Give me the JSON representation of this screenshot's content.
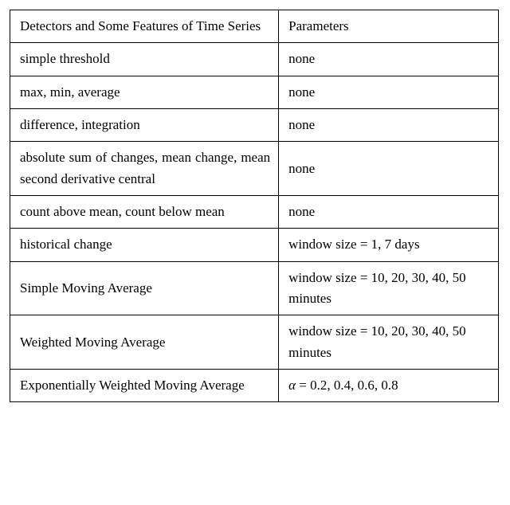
{
  "chart_data": {
    "type": "table",
    "headers": [
      "Detectors and Some Features of Time Series",
      "Parameters"
    ],
    "rows": [
      [
        "simple threshold",
        "none"
      ],
      [
        "max, min, average",
        "none"
      ],
      [
        "difference, integration",
        "none"
      ],
      [
        "absolute sum of changes, mean change, mean second derivative central",
        "none"
      ],
      [
        "count above mean, count below mean",
        "none"
      ],
      [
        "historical change",
        "window size = 1, 7 days"
      ],
      [
        "Simple Moving Average",
        "window size = 10, 20, 30, 40, 50 minutes"
      ],
      [
        "Weighted Moving Average",
        "window size = 10, 20, 30, 40, 50 minutes"
      ],
      [
        "Exponentially Weighted Moving Average",
        "α = 0.2, 0.4, 0.6, 0.8"
      ]
    ]
  }
}
